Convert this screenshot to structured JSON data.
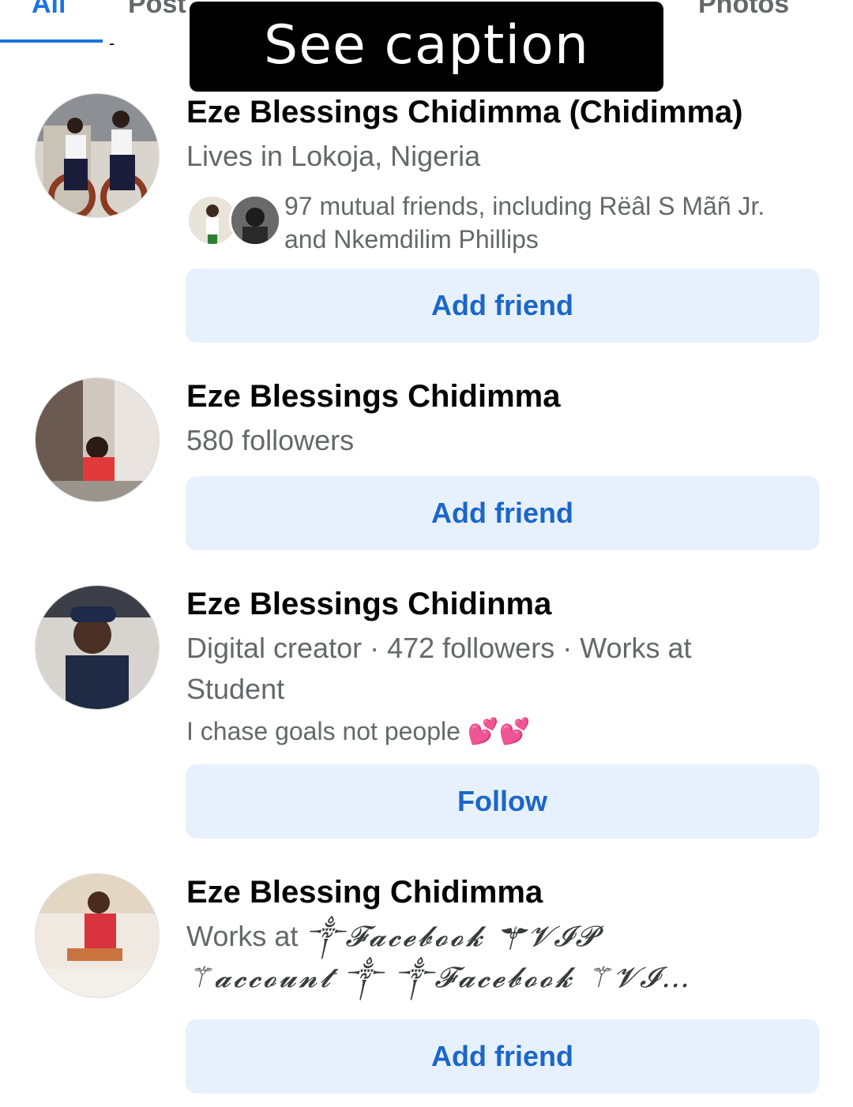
{
  "tabs": {
    "all": "All",
    "posts": "Post",
    "photos": "Photos"
  },
  "caption": "See caption >>>",
  "results": [
    {
      "name": "Eze Blessings Chidimma (Chidimma)",
      "line1": "Lives in Lokoja, Nigeria",
      "mutual_line1": "97 mutual friends, including Rëâl S Mãñ Jr.",
      "mutual_line2": "and Nkemdilim Phillips",
      "button": "Add friend"
    },
    {
      "name": "Eze Blessings Chidimma",
      "line1": "580 followers",
      "button": "Add friend"
    },
    {
      "name": "Eze Blessings Chidinma",
      "line1": "Digital creator · 472 followers · Works at",
      "line2": "Student",
      "bio": "I chase goals not people",
      "bio_emoji": "💕💕",
      "button": "Follow"
    },
    {
      "name": "Eze Blessing Chidimma",
      "works_prefix": "Works at",
      "works_fancy1": "༒𝓕𝓪𝓬𝓮𝓫𝓸𝓸𝓴 ⚚𝓥𝓘𝓟",
      "works_fancy2": "⚚𝓪𝓬𝓬𝓸𝓾𝓷𝓽 ༒ ༒𝓕𝓪𝓬𝓮𝓫𝓸𝓸𝓴 ⚚𝓥𝓘…",
      "button": "Add friend"
    }
  ],
  "colors": {
    "accent": "#1b74e4",
    "button_bg": "#e7f1fd",
    "button_text": "#1b66c9",
    "secondary_text": "#65676b"
  }
}
